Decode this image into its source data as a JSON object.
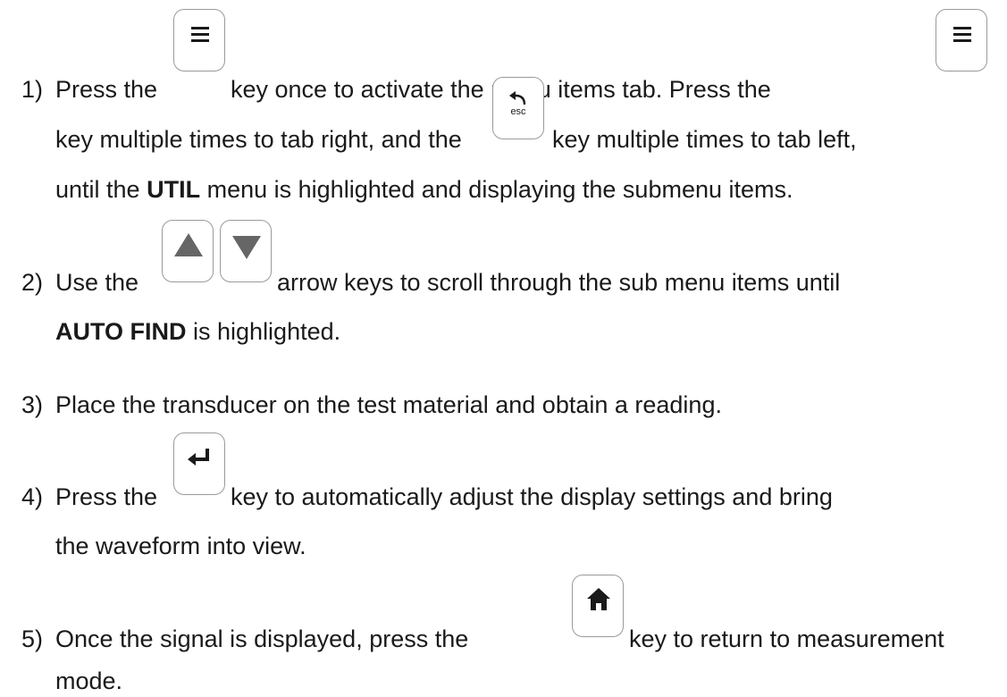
{
  "step1": {
    "number": "1)",
    "line1_a": "Press the",
    "line1_b": "key once to activate the menu items tab.  Press the",
    "line2_a": "key multiple times to tab right, and the",
    "line2_b": "key multiple times to tab left,",
    "line3_a": "until the",
    "line3_bold": "UTIL",
    "line3_b": "menu is highlighted and displaying the submenu items."
  },
  "step2": {
    "number": "2)",
    "line1_a": "Use the",
    "line1_b": "arrow keys to scroll through the sub menu items until",
    "line2_bold": "AUTO FIND",
    "line2_b": "is highlighted."
  },
  "step3": {
    "number": "3)",
    "line1": "Place the transducer on the test material and obtain a reading."
  },
  "step4": {
    "number": "4)",
    "line1_a": "Press the",
    "line1_b": "key to automatically adjust the display settings and bring",
    "line2": "the waveform into view."
  },
  "step5": {
    "number": "5)",
    "line1_a": "Once the signal is displayed, press the",
    "line1_b": "key to return to measurement",
    "line2": "mode."
  },
  "keys": {
    "esc_label": "esc",
    "colors": {
      "border": "#9a9a9a",
      "glyph": "#1a1a1a",
      "arrow": "#666666"
    }
  }
}
